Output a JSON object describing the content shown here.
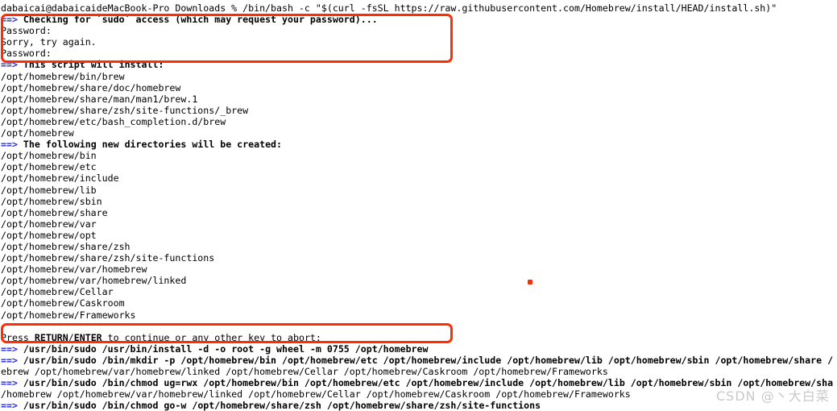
{
  "terminal": {
    "prompt_line": "dabaicai@dabaicaideMacBook-Pro Downloads % /bin/bash -c \"$(curl -fsSL https://raw.githubusercontent.com/Homebrew/install/HEAD/install.sh)\"",
    "arrow_prefix": "==>",
    "lines": [
      {
        "type": "header",
        "text": " Checking for `sudo` access (which may request your password)..."
      },
      {
        "type": "plain",
        "text": "Password:"
      },
      {
        "type": "plain",
        "text": "Sorry, try again."
      },
      {
        "type": "plain",
        "text": "Password:"
      },
      {
        "type": "header",
        "text": " This script will install:"
      },
      {
        "type": "plain",
        "text": "/opt/homebrew/bin/brew"
      },
      {
        "type": "plain",
        "text": "/opt/homebrew/share/doc/homebrew"
      },
      {
        "type": "plain",
        "text": "/opt/homebrew/share/man/man1/brew.1"
      },
      {
        "type": "plain",
        "text": "/opt/homebrew/share/zsh/site-functions/_brew"
      },
      {
        "type": "plain",
        "text": "/opt/homebrew/etc/bash_completion.d/brew"
      },
      {
        "type": "plain",
        "text": "/opt/homebrew"
      },
      {
        "type": "header",
        "text": " The following new directories will be created:"
      },
      {
        "type": "plain",
        "text": "/opt/homebrew/bin"
      },
      {
        "type": "plain",
        "text": "/opt/homebrew/etc"
      },
      {
        "type": "plain",
        "text": "/opt/homebrew/include"
      },
      {
        "type": "plain",
        "text": "/opt/homebrew/lib"
      },
      {
        "type": "plain",
        "text": "/opt/homebrew/sbin"
      },
      {
        "type": "plain",
        "text": "/opt/homebrew/share"
      },
      {
        "type": "plain",
        "text": "/opt/homebrew/var"
      },
      {
        "type": "plain",
        "text": "/opt/homebrew/opt"
      },
      {
        "type": "plain",
        "text": "/opt/homebrew/share/zsh"
      },
      {
        "type": "plain",
        "text": "/opt/homebrew/share/zsh/site-functions"
      },
      {
        "type": "plain",
        "text": "/opt/homebrew/var/homebrew"
      },
      {
        "type": "plain",
        "text": "/opt/homebrew/var/homebrew/linked"
      },
      {
        "type": "plain",
        "text": "/opt/homebrew/Cellar"
      },
      {
        "type": "plain",
        "text": "/opt/homebrew/Caskroom"
      },
      {
        "type": "plain",
        "text": "/opt/homebrew/Frameworks"
      },
      {
        "type": "blank",
        "text": ""
      },
      {
        "type": "prompt_return",
        "text": "Press RETURN/ENTER to continue or any other key to abort:"
      },
      {
        "type": "header",
        "text": " /usr/bin/sudo /usr/bin/install -d -o root -g wheel -m 0755 /opt/homebrew"
      },
      {
        "type": "header",
        "text": " /usr/bin/sudo /bin/mkdir -p /opt/homebrew/bin /opt/homebrew/etc /opt/homebrew/include /opt/homebrew/lib /opt/homebrew/sbin /opt/homebrew/share /"
      },
      {
        "type": "plain",
        "text": "ebrew /opt/homebrew/var/homebrew/linked /opt/homebrew/Cellar /opt/homebrew/Caskroom /opt/homebrew/Frameworks"
      },
      {
        "type": "header",
        "text": " /usr/bin/sudo /bin/chmod ug=rwx /opt/homebrew/bin /opt/homebrew/etc /opt/homebrew/include /opt/homebrew/lib /opt/homebrew/sbin /opt/homebrew/sha"
      },
      {
        "type": "plain",
        "text": "/homebrew /opt/homebrew/var/homebrew/linked /opt/homebrew/Cellar /opt/homebrew/Caskroom /opt/homebrew/Frameworks"
      },
      {
        "type": "header",
        "text": " /usr/bin/sudo /bin/chmod go-w /opt/homebrew/share/zsh /opt/homebrew/share/zsh/site-functions"
      }
    ],
    "press_return": {
      "before": "Press ",
      "key1": "RETURN",
      "slash": "/",
      "key2": "ENTER",
      "after": " to continue or any other key to abort:"
    }
  },
  "annotations": {
    "watermark": "CSDN @丶大白菜",
    "box_color": "#ff2d00",
    "arrow_color": "#2a2ad2"
  }
}
